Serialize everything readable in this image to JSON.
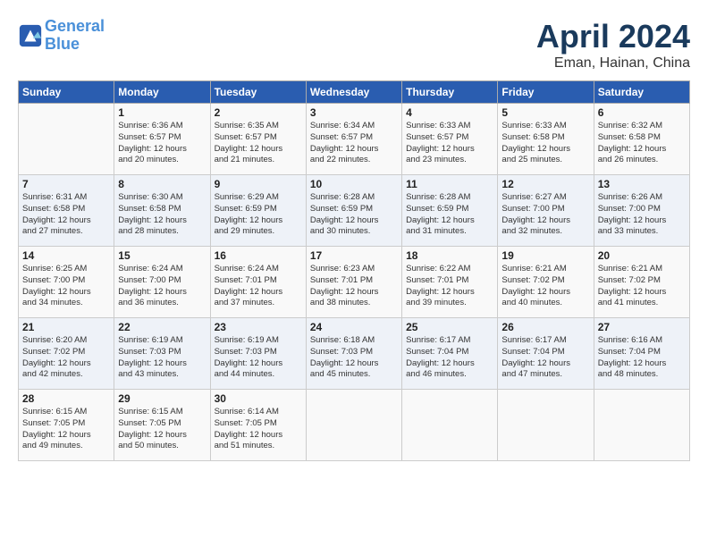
{
  "header": {
    "logo_line1": "General",
    "logo_line2": "Blue",
    "month": "April 2024",
    "location": "Eman, Hainan, China"
  },
  "weekdays": [
    "Sunday",
    "Monday",
    "Tuesday",
    "Wednesday",
    "Thursday",
    "Friday",
    "Saturday"
  ],
  "weeks": [
    [
      {
        "day": "",
        "info": ""
      },
      {
        "day": "1",
        "info": "Sunrise: 6:36 AM\nSunset: 6:57 PM\nDaylight: 12 hours\nand 20 minutes."
      },
      {
        "day": "2",
        "info": "Sunrise: 6:35 AM\nSunset: 6:57 PM\nDaylight: 12 hours\nand 21 minutes."
      },
      {
        "day": "3",
        "info": "Sunrise: 6:34 AM\nSunset: 6:57 PM\nDaylight: 12 hours\nand 22 minutes."
      },
      {
        "day": "4",
        "info": "Sunrise: 6:33 AM\nSunset: 6:57 PM\nDaylight: 12 hours\nand 23 minutes."
      },
      {
        "day": "5",
        "info": "Sunrise: 6:33 AM\nSunset: 6:58 PM\nDaylight: 12 hours\nand 25 minutes."
      },
      {
        "day": "6",
        "info": "Sunrise: 6:32 AM\nSunset: 6:58 PM\nDaylight: 12 hours\nand 26 minutes."
      }
    ],
    [
      {
        "day": "7",
        "info": "Sunrise: 6:31 AM\nSunset: 6:58 PM\nDaylight: 12 hours\nand 27 minutes."
      },
      {
        "day": "8",
        "info": "Sunrise: 6:30 AM\nSunset: 6:58 PM\nDaylight: 12 hours\nand 28 minutes."
      },
      {
        "day": "9",
        "info": "Sunrise: 6:29 AM\nSunset: 6:59 PM\nDaylight: 12 hours\nand 29 minutes."
      },
      {
        "day": "10",
        "info": "Sunrise: 6:28 AM\nSunset: 6:59 PM\nDaylight: 12 hours\nand 30 minutes."
      },
      {
        "day": "11",
        "info": "Sunrise: 6:28 AM\nSunset: 6:59 PM\nDaylight: 12 hours\nand 31 minutes."
      },
      {
        "day": "12",
        "info": "Sunrise: 6:27 AM\nSunset: 7:00 PM\nDaylight: 12 hours\nand 32 minutes."
      },
      {
        "day": "13",
        "info": "Sunrise: 6:26 AM\nSunset: 7:00 PM\nDaylight: 12 hours\nand 33 minutes."
      }
    ],
    [
      {
        "day": "14",
        "info": "Sunrise: 6:25 AM\nSunset: 7:00 PM\nDaylight: 12 hours\nand 34 minutes."
      },
      {
        "day": "15",
        "info": "Sunrise: 6:24 AM\nSunset: 7:00 PM\nDaylight: 12 hours\nand 36 minutes."
      },
      {
        "day": "16",
        "info": "Sunrise: 6:24 AM\nSunset: 7:01 PM\nDaylight: 12 hours\nand 37 minutes."
      },
      {
        "day": "17",
        "info": "Sunrise: 6:23 AM\nSunset: 7:01 PM\nDaylight: 12 hours\nand 38 minutes."
      },
      {
        "day": "18",
        "info": "Sunrise: 6:22 AM\nSunset: 7:01 PM\nDaylight: 12 hours\nand 39 minutes."
      },
      {
        "day": "19",
        "info": "Sunrise: 6:21 AM\nSunset: 7:02 PM\nDaylight: 12 hours\nand 40 minutes."
      },
      {
        "day": "20",
        "info": "Sunrise: 6:21 AM\nSunset: 7:02 PM\nDaylight: 12 hours\nand 41 minutes."
      }
    ],
    [
      {
        "day": "21",
        "info": "Sunrise: 6:20 AM\nSunset: 7:02 PM\nDaylight: 12 hours\nand 42 minutes."
      },
      {
        "day": "22",
        "info": "Sunrise: 6:19 AM\nSunset: 7:03 PM\nDaylight: 12 hours\nand 43 minutes."
      },
      {
        "day": "23",
        "info": "Sunrise: 6:19 AM\nSunset: 7:03 PM\nDaylight: 12 hours\nand 44 minutes."
      },
      {
        "day": "24",
        "info": "Sunrise: 6:18 AM\nSunset: 7:03 PM\nDaylight: 12 hours\nand 45 minutes."
      },
      {
        "day": "25",
        "info": "Sunrise: 6:17 AM\nSunset: 7:04 PM\nDaylight: 12 hours\nand 46 minutes."
      },
      {
        "day": "26",
        "info": "Sunrise: 6:17 AM\nSunset: 7:04 PM\nDaylight: 12 hours\nand 47 minutes."
      },
      {
        "day": "27",
        "info": "Sunrise: 6:16 AM\nSunset: 7:04 PM\nDaylight: 12 hours\nand 48 minutes."
      }
    ],
    [
      {
        "day": "28",
        "info": "Sunrise: 6:15 AM\nSunset: 7:05 PM\nDaylight: 12 hours\nand 49 minutes."
      },
      {
        "day": "29",
        "info": "Sunrise: 6:15 AM\nSunset: 7:05 PM\nDaylight: 12 hours\nand 50 minutes."
      },
      {
        "day": "30",
        "info": "Sunrise: 6:14 AM\nSunset: 7:05 PM\nDaylight: 12 hours\nand 51 minutes."
      },
      {
        "day": "",
        "info": ""
      },
      {
        "day": "",
        "info": ""
      },
      {
        "day": "",
        "info": ""
      },
      {
        "day": "",
        "info": ""
      }
    ]
  ]
}
